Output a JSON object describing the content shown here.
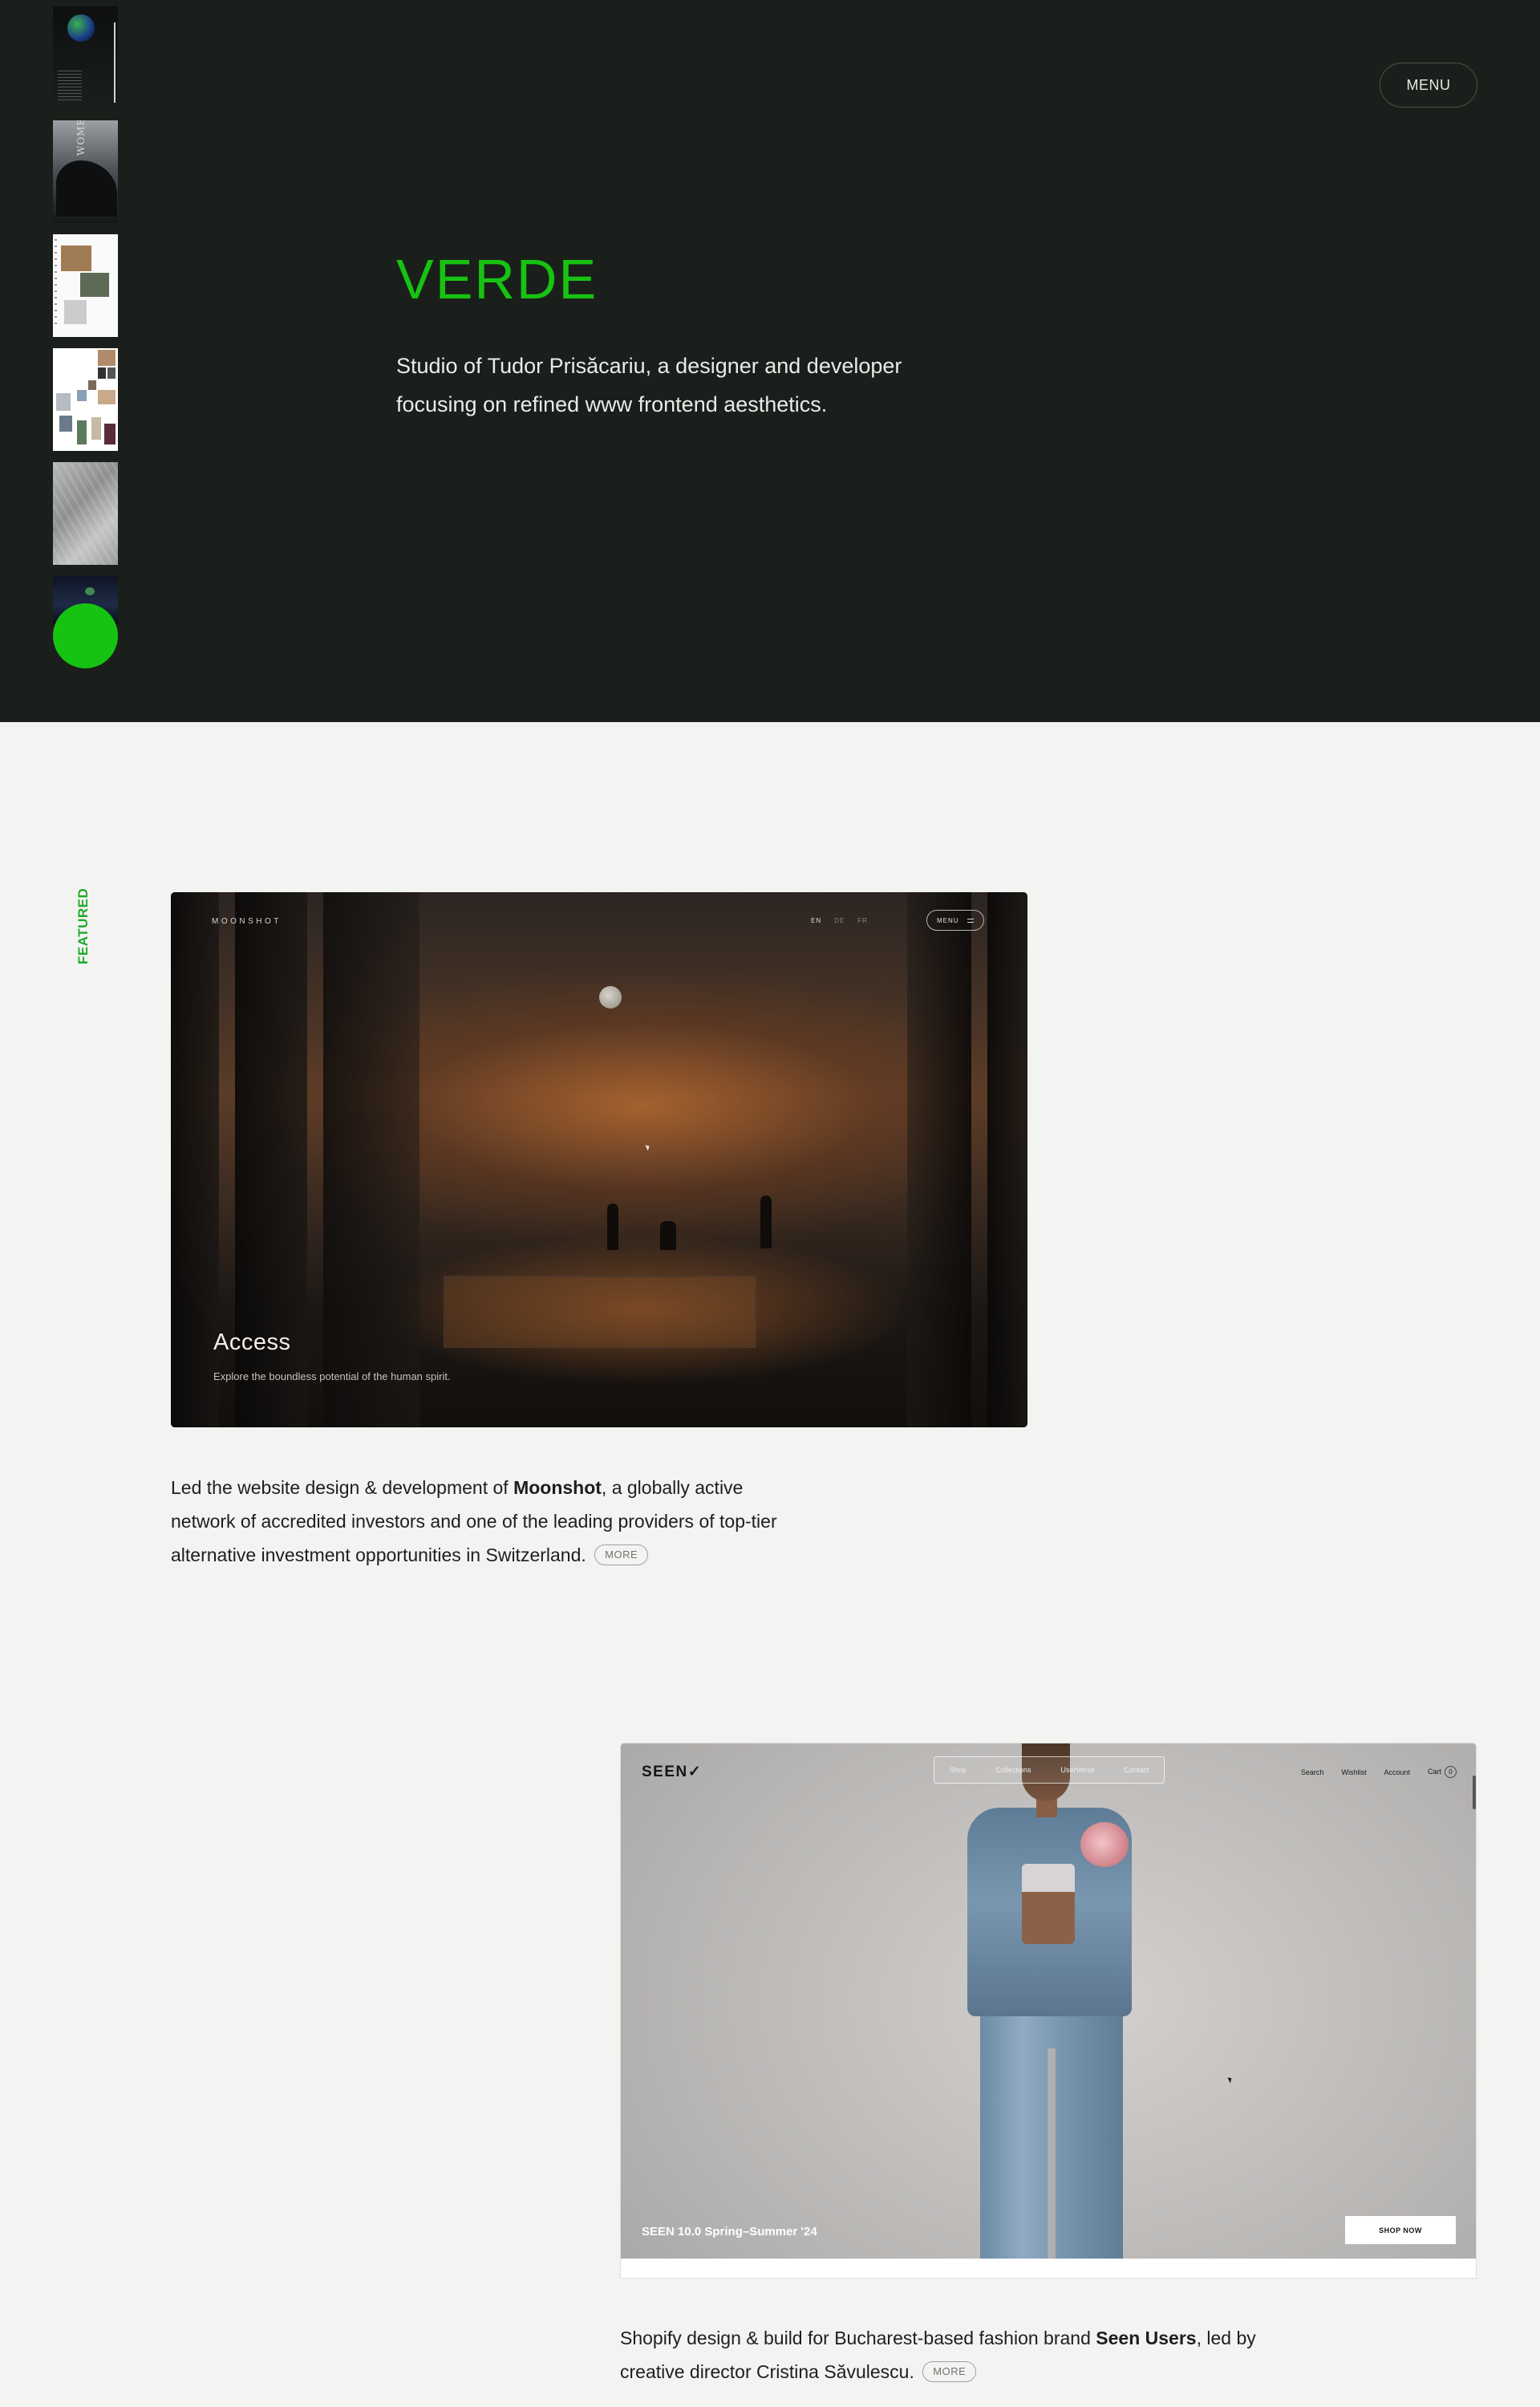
{
  "hero": {
    "menu_label": "MENU",
    "title": "VERDE",
    "description": "Studio of Tudor Prisăcariu, a designer and developer focusing on refined www frontend aesthetics.",
    "thumb_word": "WOMEN",
    "accent_color": "#17c312",
    "background_color": "#1b1f1b"
  },
  "section": {
    "featured_label": "FEATURED"
  },
  "projects": [
    {
      "screenshot": {
        "logo": "MOONSHOT",
        "languages": [
          "EN",
          "DE",
          "FR"
        ],
        "menu_label": "MENU",
        "headline": "Access",
        "subline": "Explore the boundless potential of the human spirit."
      },
      "desc_before": "Led the website design & development of ",
      "desc_bold": "Moonshot",
      "desc_after": ", a globally active network of accredited investors and one of the leading providers of top-tier alternative investment opportunities in Switzerland.",
      "more_label": "MORE"
    },
    {
      "screenshot": {
        "logo": "SEEN✓",
        "nav": [
          "Shop",
          "Collections",
          "UserVerse",
          "Contact"
        ],
        "right_links": [
          "Search",
          "Wishlist",
          "Account",
          "Cart"
        ],
        "cart_count": "0",
        "caption": "SEEN 10.0 Spring–Summer '24",
        "cta": "SHOP NOW"
      },
      "desc_before": "Shopify design & build for Bucharest-based fashion brand ",
      "desc_bold": "Seen Users",
      "desc_after": ", led by creative director Cristina Săvulescu.",
      "more_label": "MORE"
    }
  ]
}
